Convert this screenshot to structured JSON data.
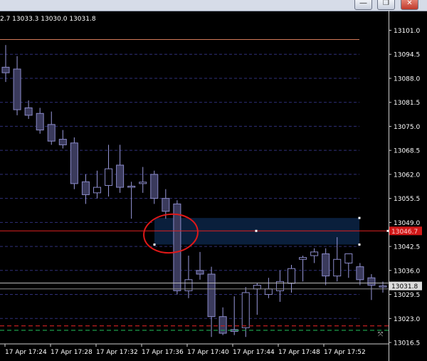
{
  "window": {
    "buttons": {
      "minimize": "—",
      "maximize": "❐",
      "close": "✕"
    }
  },
  "ohlc_text": "2.7 13033.3 13030.0 13031.8",
  "colors": {
    "background": "#000000",
    "bull_body": "#000000",
    "bear_body": "#3a3a5c",
    "candle_outline": "#8a8ac8",
    "wick": "#9a9adc",
    "grid": "#30307a",
    "top_line": "#d27a5a",
    "red_line": "#e02020",
    "zone_fill": "#0a1f3c",
    "circle": "#e01818",
    "current_price_label_bg": "#dddddd",
    "red_label_bg": "#d01818",
    "green_dash": "#1c9c4a",
    "red_dash": "#c02020"
  },
  "chart_data": {
    "type": "candlestick",
    "y_axis": {
      "ylim": [
        13013,
        13105
      ],
      "ticks": [
        "13101.0",
        "13094.5",
        "13088.0",
        "13081.5",
        "13075.0",
        "13068.5",
        "13062.0",
        "13055.5",
        "13049.0",
        "13042.5",
        "13036.0",
        "13029.5",
        "13023.0",
        "13016.5"
      ]
    },
    "x_axis": {
      "ticks": [
        "17 Apr 17:24",
        "17 Apr 17:28",
        "17 Apr 17:32",
        "17 Apr 17:36",
        "17 Apr 17:40",
        "17 Apr 17:44",
        "17 Apr 17:48",
        "17 Apr 17:52"
      ]
    },
    "candles": [
      {
        "o": 13091.0,
        "h": 13097.0,
        "l": 13087.0,
        "c": 13089.5
      },
      {
        "o": 13090.5,
        "h": 13094.0,
        "l": 13078.0,
        "c": 13079.5
      },
      {
        "o": 13080.0,
        "h": 13082.0,
        "l": 13077.0,
        "c": 13078.0
      },
      {
        "o": 13078.5,
        "h": 13080.0,
        "l": 13073.0,
        "c": 13074.0
      },
      {
        "o": 13075.5,
        "h": 13079.0,
        "l": 13070.0,
        "c": 13071.0
      },
      {
        "o": 13071.5,
        "h": 13074.0,
        "l": 13069.0,
        "c": 13070.0
      },
      {
        "o": 13070.5,
        "h": 13072.0,
        "l": 13058.0,
        "c": 13059.5
      },
      {
        "o": 13060.0,
        "h": 13062.0,
        "l": 13054.0,
        "c": 13056.5
      },
      {
        "o": 13057.0,
        "h": 13063.0,
        "l": 13055.5,
        "c": 13058.5
      },
      {
        "o": 13059.0,
        "h": 13070.0,
        "l": 13056.0,
        "c": 13063.5
      },
      {
        "o": 13064.5,
        "h": 13070.0,
        "l": 13057.0,
        "c": 13058.5
      },
      {
        "o": 13058.5,
        "h": 13060.0,
        "l": 13050.0,
        "c": 13058.8
      },
      {
        "o": 13059.5,
        "h": 13064.0,
        "l": 13057.0,
        "c": 13059.9
      },
      {
        "o": 13062.0,
        "h": 13063.0,
        "l": 13054.0,
        "c": 13055.5
      },
      {
        "o": 13055.5,
        "h": 13058.0,
        "l": 13050.0,
        "c": 13052.0
      },
      {
        "o": 13054.0,
        "h": 13055.0,
        "l": 13029.5,
        "c": 13030.5
      },
      {
        "o": 13030.5,
        "h": 13040.0,
        "l": 13028.5,
        "c": 13033.5
      },
      {
        "o": 13036.0,
        "h": 13041.0,
        "l": 13033.5,
        "c": 13035.0
      },
      {
        "o": 13035.0,
        "h": 13037.0,
        "l": 13018.0,
        "c": 13023.5
      },
      {
        "o": 13023.5,
        "h": 13026.0,
        "l": 13018.5,
        "c": 13019.0
      },
      {
        "o": 13020.0,
        "h": 13029.0,
        "l": 13018.5,
        "c": 13019.5
      },
      {
        "o": 13020.5,
        "h": 13031.5,
        "l": 13018.0,
        "c": 13030.0
      },
      {
        "o": 13031.0,
        "h": 13032.5,
        "l": 13024.0,
        "c": 13032.0
      },
      {
        "o": 13029.5,
        "h": 13034.0,
        "l": 13028.5,
        "c": 13031.0
      },
      {
        "o": 13030.5,
        "h": 13036.0,
        "l": 13027.5,
        "c": 13033.0
      },
      {
        "o": 13032.5,
        "h": 13037.5,
        "l": 13030.0,
        "c": 13036.5
      },
      {
        "o": 13039.0,
        "h": 13040.0,
        "l": 13033.0,
        "c": 13039.5
      },
      {
        "o": 13040.0,
        "h": 13042.0,
        "l": 13038.0,
        "c": 13041.0
      },
      {
        "o": 13040.5,
        "h": 13042.0,
        "l": 13032.0,
        "c": 13034.5
      },
      {
        "o": 13034.5,
        "h": 13045.0,
        "l": 13033.0,
        "c": 13039.0
      },
      {
        "o": 13038.0,
        "h": 13040.0,
        "l": 13034.0,
        "c": 13040.5
      },
      {
        "o": 13037.0,
        "h": 13038.0,
        "l": 13032.0,
        "c": 13033.5
      },
      {
        "o": 13034.0,
        "h": 13035.0,
        "l": 13028.0,
        "c": 13032.0
      },
      {
        "o": 13031.5,
        "h": 13033.0,
        "l": 13030.0,
        "c": 13031.8
      }
    ],
    "levels": {
      "top_line": 13098.5,
      "red_line": 13046.7,
      "zone_top": 13050.2,
      "zone_bottom": 13043.0,
      "current_price": 13031.8,
      "current_price_band": [
        13032.6,
        13031.0
      ],
      "red_dash": 13021.0,
      "green_dash": 13019.8
    },
    "price_labels": {
      "red_line": "13046.7",
      "current_price": "13031.8"
    }
  }
}
